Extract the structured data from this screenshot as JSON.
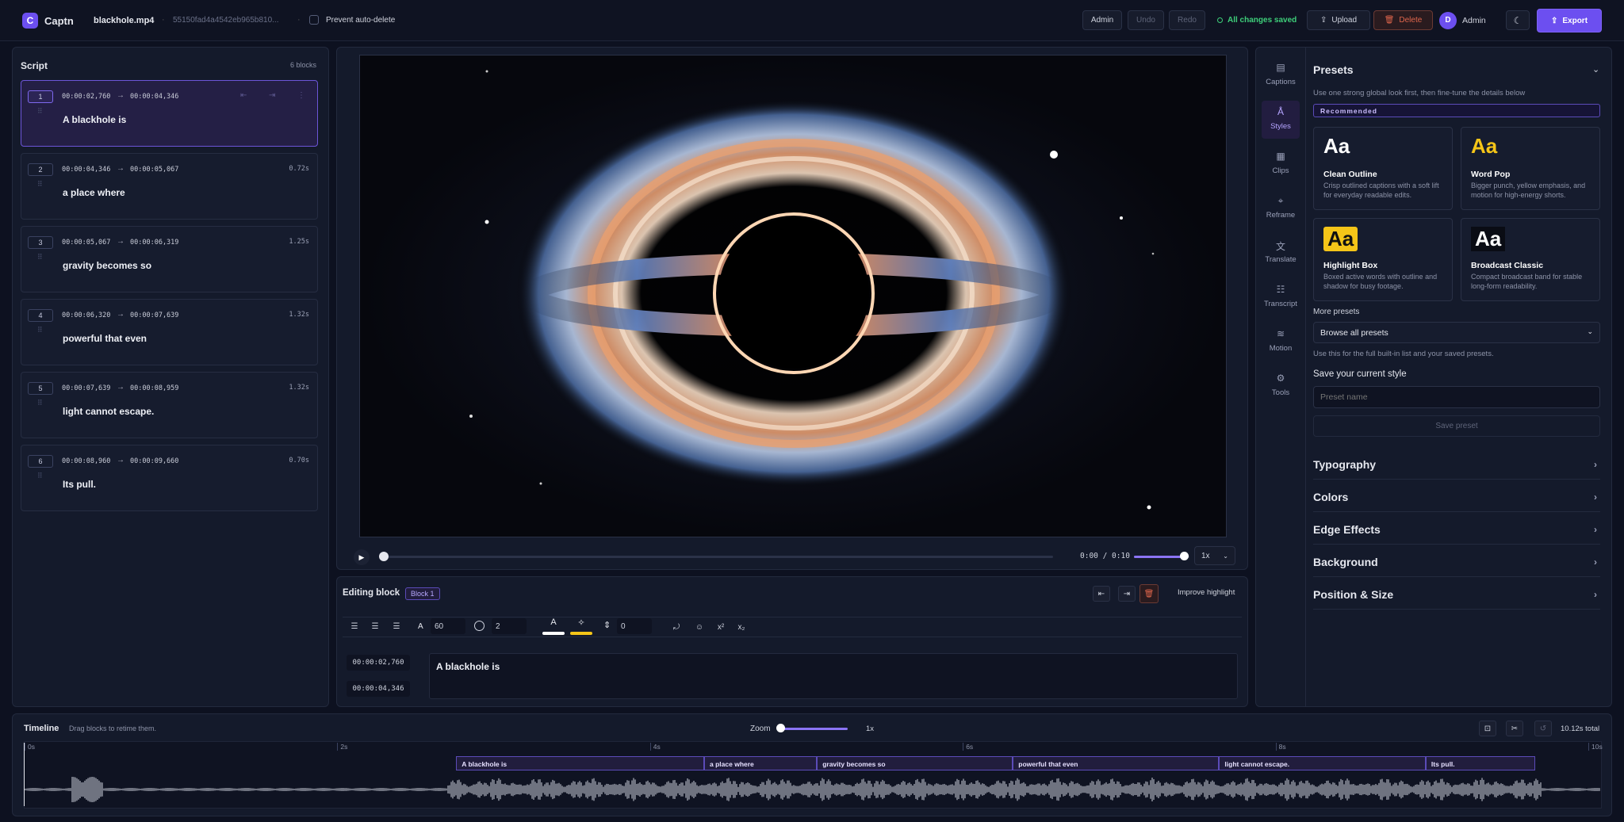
{
  "header": {
    "app_name": "Captn",
    "file_name": "blackhole.mp4",
    "file_id": "55150fad4a4542eb965b810...",
    "prevent_label": "Prevent auto-delete",
    "admin_btn": "Admin",
    "undo_btn": "Undo",
    "redo_btn": "Redo",
    "saved_status": "All changes saved",
    "upload_btn": "Upload",
    "delete_btn": "Delete",
    "avatar_letter": "D",
    "user_name": "Admin",
    "export_btn": "Export"
  },
  "script": {
    "title": "Script",
    "count": "6 blocks",
    "blocks": [
      {
        "num": "1",
        "start": "00:00:02,760",
        "end": "00:00:04,346",
        "dur": "",
        "text": "A blackhole is"
      },
      {
        "num": "2",
        "start": "00:00:04,346",
        "end": "00:00:05,067",
        "dur": "0.72s",
        "text": "a place where"
      },
      {
        "num": "3",
        "start": "00:00:05,067",
        "end": "00:00:06,319",
        "dur": "1.25s",
        "text": "gravity becomes so"
      },
      {
        "num": "4",
        "start": "00:00:06,320",
        "end": "00:00:07,639",
        "dur": "1.32s",
        "text": "powerful that even"
      },
      {
        "num": "5",
        "start": "00:00:07,639",
        "end": "00:00:08,959",
        "dur": "1.32s",
        "text": "light cannot escape."
      },
      {
        "num": "6",
        "start": "00:00:08,960",
        "end": "00:00:09,660",
        "dur": "0.70s",
        "text": "Its pull."
      }
    ]
  },
  "player": {
    "time": "0:00 / 0:10",
    "speed": "1x",
    "volume": 0.9,
    "progress": 0.0
  },
  "editing": {
    "title": "Editing block",
    "badge": "Block 1",
    "improve": "Improve highlight",
    "font_size": "60",
    "stroke": "2",
    "spacing": "0",
    "start": "00:00:02,760",
    "end": "00:00:04,346",
    "text": "A blackhole is"
  },
  "rail": [
    {
      "label": "Captions",
      "icon": "captions-icon"
    },
    {
      "label": "Styles",
      "icon": "styles-icon"
    },
    {
      "label": "Clips",
      "icon": "clips-icon"
    },
    {
      "label": "Reframe",
      "icon": "reframe-icon"
    },
    {
      "label": "Translate",
      "icon": "translate-icon"
    },
    {
      "label": "Transcript",
      "icon": "transcript-icon"
    },
    {
      "label": "Motion",
      "icon": "motion-icon"
    },
    {
      "label": "Tools",
      "icon": "tools-icon"
    }
  ],
  "presets": {
    "title": "Presets",
    "hint": "Use one strong global look first, then fine-tune the details below",
    "recommended": "Recommended",
    "cards": [
      {
        "sample": "Aa",
        "name": "Clean Outline",
        "desc": "Crisp outlined captions with a soft lift for everyday readable edits."
      },
      {
        "sample": "Aa",
        "name": "Word Pop",
        "desc": "Bigger punch, yellow emphasis, and motion for high-energy shorts."
      },
      {
        "sample": "Aa",
        "name": "Highlight Box",
        "desc": "Boxed active words with outline and shadow for busy footage."
      },
      {
        "sample": "Aa",
        "name": "Broadcast Classic",
        "desc": "Compact broadcast band for stable long-form readability."
      }
    ],
    "more": "More presets",
    "browse": "Browse all presets",
    "browse_hint": "Use this for the full built-in list and your saved presets.",
    "save_title": "Save your current style",
    "preset_placeholder": "Preset name",
    "save_btn": "Save preset"
  },
  "sections": [
    "Typography",
    "Colors",
    "Edge Effects",
    "Background",
    "Position & Size"
  ],
  "timeline": {
    "title": "Timeline",
    "hint": "Drag blocks to retime them.",
    "zoom": "Zoom",
    "zoom_val": "1x",
    "total": "10.12s total",
    "ticks": [
      "0s",
      "2s",
      "4s",
      "6s",
      "8s",
      "10s"
    ],
    "blocks": [
      "A blackhole is",
      "a place where",
      "gravity becomes so",
      "powerful that even",
      "light cannot escape.",
      "Its pull."
    ]
  },
  "colors": {
    "accent": "#6c4ff0",
    "bg": "#0d1120",
    "panel": "#141a2b",
    "saved": "#3ecf7a",
    "delete": "#e0664c",
    "yellow": "#f5c518"
  }
}
